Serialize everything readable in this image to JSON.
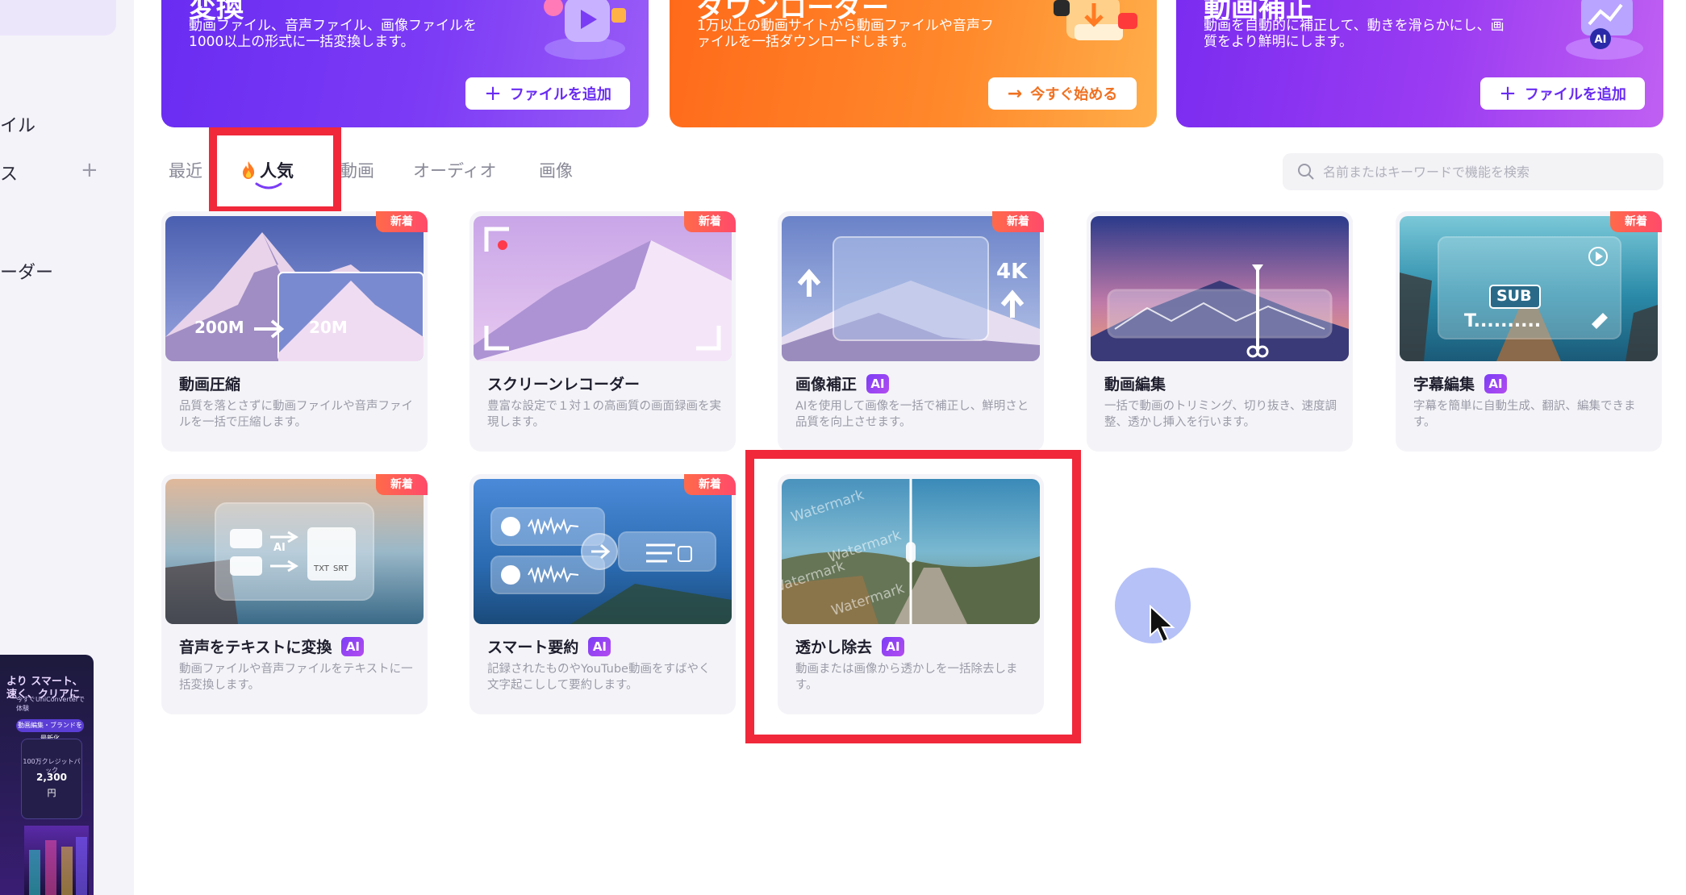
{
  "sidebar": {
    "item_file_suffix": "イル",
    "item_x_suffix": "ス",
    "plus_label": "+",
    "item_loader_suffix": "ーダー",
    "promo": {
      "headline": "より スマート、速く、クリアに",
      "sub": "今すぐUniConverterで体験",
      "pill": "動画編集・ブランドを最新化",
      "box_label": "100万クレジットパック",
      "box_value": "2,300",
      "box_unit": "円"
    }
  },
  "banners": [
    {
      "title": "変換",
      "desc": "動画ファイル、音声ファイル、画像ファイルを1000以上の形式に一括変換します。",
      "button": "ファイルを追加",
      "button_icon": "plus-icon"
    },
    {
      "title": "ダウンローダー",
      "desc": "1万以上の動画サイトから動画ファイルや音声ファイルを一括ダウンロードします。",
      "button": "今すぐ始める",
      "button_icon": "arrow-right-icon"
    },
    {
      "title": "動画補正",
      "desc": "動画を自動的に補正して、動きを滑らかにし、画質をより鮮明にします。",
      "button": "ファイルを追加",
      "button_icon": "plus-icon"
    }
  ],
  "tabs": {
    "recent": "最近",
    "popular": "人気",
    "video": "動画",
    "audio": "オーディオ",
    "image": "画像"
  },
  "search": {
    "placeholder": "名前またはキーワードで機能を検索"
  },
  "cards": [
    {
      "title": "動画圧縮",
      "desc": "品質を落とさずに動画ファイルや音声ファイルを一括で圧縮します。",
      "ai": false,
      "new": true,
      "size_from": "200M",
      "size_to": "20M"
    },
    {
      "title": "スクリーンレコーダー",
      "desc": "豊富な設定で１対１の高画質の画面録画を実現します。",
      "ai": false,
      "new": true
    },
    {
      "title": "画像補正",
      "desc": "AIを使用して画像を一括で補正し、鮮明さと品質を向上させます。",
      "ai": true,
      "new": true,
      "res_label": "4K"
    },
    {
      "title": "動画編集",
      "desc": "一括で動画のトリミング、切り抜き、速度調整、透かし挿入を行います。",
      "ai": false,
      "new": false
    },
    {
      "title": "字幕編集",
      "desc": "字幕を簡単に自動生成、翻訳、編集できます。",
      "ai": true,
      "new": true,
      "sub_label": "SUB",
      "sub_text": "T.........."
    },
    {
      "title": "音声をテキストに変換",
      "desc": "動画ファイルや音声ファイルをテキストに一括変換します。",
      "ai": true,
      "new": true,
      "ai_label": "AI",
      "txt_label": "TXT",
      "srt_label": "SRT"
    },
    {
      "title": "スマート要約",
      "desc": "記録されたものやYouTube動画をすばやく文字起こしして要約します。",
      "ai": true,
      "new": true
    },
    {
      "title": "透かし除去",
      "desc": "動画または画像から透かしを一括除去します。",
      "ai": true,
      "new": false,
      "watermark": "Watermark"
    }
  ],
  "badges": {
    "ai": "AI",
    "new": "新着"
  },
  "colors": {
    "accent": "#6a2cf2",
    "orange": "#ff7a22",
    "highlight": "#f0283a",
    "cursor_halo": "#a8b6f6"
  }
}
